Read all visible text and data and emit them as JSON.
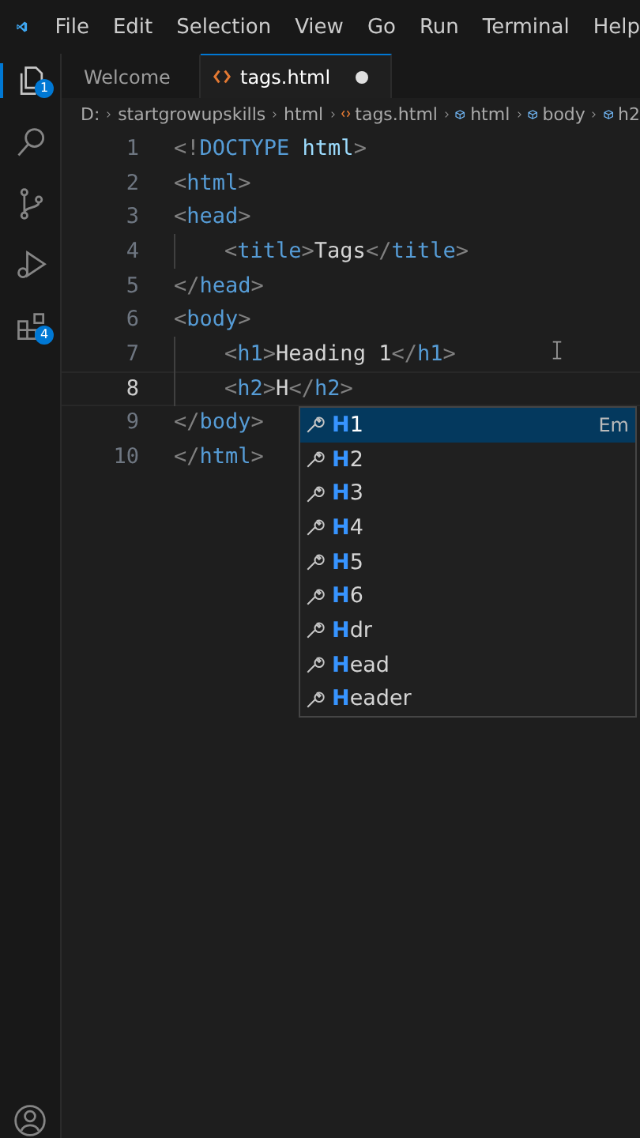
{
  "menu": [
    "File",
    "Edit",
    "Selection",
    "View",
    "Go",
    "Run",
    "Terminal",
    "Help"
  ],
  "activity_bar": [
    {
      "kind": "files",
      "badge": "1",
      "selected": true
    },
    {
      "kind": "search",
      "selected": false
    },
    {
      "kind": "source-control",
      "selected": false
    },
    {
      "kind": "run-debug",
      "selected": false
    },
    {
      "kind": "extensions",
      "badge": "4",
      "selected": false
    }
  ],
  "tabs": [
    {
      "label": "Welcome",
      "kind": "vscode",
      "selected": false
    },
    {
      "label": "tags.html",
      "kind": "html",
      "selected": true,
      "dirty": true
    }
  ],
  "breadcrumbs": [
    {
      "label": "D:",
      "kind": "folder"
    },
    {
      "label": "startgrowupskills",
      "kind": "folder"
    },
    {
      "label": "html",
      "kind": "folder"
    },
    {
      "label": "tags.html",
      "kind": "html"
    },
    {
      "label": "html",
      "kind": "element"
    },
    {
      "label": "body",
      "kind": "element"
    },
    {
      "label": "h2",
      "kind": "element"
    }
  ],
  "editor": {
    "lines": [
      {
        "number": "1",
        "current": false,
        "indent": false,
        "tokens": [
          {
            "kind": "punct",
            "text": "<!"
          },
          {
            "kind": "tag",
            "text": "DOCTYPE"
          },
          {
            "kind": "attr",
            "text": " html"
          },
          {
            "kind": "punct",
            "text": ">"
          }
        ]
      },
      {
        "number": "2",
        "current": false,
        "indent": false,
        "tokens": [
          {
            "kind": "punct",
            "text": "<"
          },
          {
            "kind": "tag",
            "text": "html"
          },
          {
            "kind": "punct",
            "text": ">"
          }
        ]
      },
      {
        "number": "3",
        "current": false,
        "indent": false,
        "tokens": [
          {
            "kind": "punct",
            "text": "<"
          },
          {
            "kind": "tag",
            "text": "head"
          },
          {
            "kind": "punct",
            "text": ">"
          }
        ]
      },
      {
        "number": "4",
        "current": false,
        "indent": true,
        "tokens": [
          {
            "kind": "punct",
            "text": "<"
          },
          {
            "kind": "tag",
            "text": "title"
          },
          {
            "kind": "punct",
            "text": ">"
          },
          {
            "kind": "text",
            "text": "Tags"
          },
          {
            "kind": "punct",
            "text": "</"
          },
          {
            "kind": "tag",
            "text": "title"
          },
          {
            "kind": "punct",
            "text": ">"
          }
        ]
      },
      {
        "number": "5",
        "current": false,
        "indent": false,
        "tokens": [
          {
            "kind": "punct",
            "text": "</"
          },
          {
            "kind": "tag",
            "text": "head"
          },
          {
            "kind": "punct",
            "text": ">"
          }
        ]
      },
      {
        "number": "6",
        "current": false,
        "indent": false,
        "tokens": [
          {
            "kind": "punct",
            "text": "<"
          },
          {
            "kind": "tag",
            "text": "body"
          },
          {
            "kind": "punct",
            "text": ">"
          }
        ]
      },
      {
        "number": "7",
        "current": false,
        "indent": true,
        "tokens": [
          {
            "kind": "punct",
            "text": "<"
          },
          {
            "kind": "tag",
            "text": "h1"
          },
          {
            "kind": "punct",
            "text": ">"
          },
          {
            "kind": "text",
            "text": "Heading 1"
          },
          {
            "kind": "punct",
            "text": "</"
          },
          {
            "kind": "tag",
            "text": "h1"
          },
          {
            "kind": "punct",
            "text": ">"
          }
        ]
      },
      {
        "number": "8",
        "current": true,
        "indent": true,
        "tokens": [
          {
            "kind": "punct",
            "text": "<"
          },
          {
            "kind": "tag",
            "text": "h2"
          },
          {
            "kind": "punct",
            "text": ">"
          },
          {
            "kind": "text",
            "text": "H"
          },
          {
            "kind": "punct",
            "text": "</"
          },
          {
            "kind": "tag",
            "text": "h2"
          },
          {
            "kind": "punct",
            "text": ">"
          }
        ]
      },
      {
        "number": "9",
        "current": false,
        "indent": false,
        "tokens": [
          {
            "kind": "punct",
            "text": "</"
          },
          {
            "kind": "tag",
            "text": "body"
          },
          {
            "kind": "punct",
            "text": ">"
          }
        ]
      },
      {
        "number": "10",
        "current": false,
        "indent": false,
        "tokens": [
          {
            "kind": "punct",
            "text": "</"
          },
          {
            "kind": "tag",
            "text": "html"
          },
          {
            "kind": "punct",
            "text": ">"
          }
        ]
      }
    ]
  },
  "suggestions": [
    {
      "match": "H",
      "rest": "1",
      "detail": "Em",
      "selected": true
    },
    {
      "match": "H",
      "rest": "2",
      "selected": false
    },
    {
      "match": "H",
      "rest": "3",
      "selected": false
    },
    {
      "match": "H",
      "rest": "4",
      "selected": false
    },
    {
      "match": "H",
      "rest": "5",
      "selected": false
    },
    {
      "match": "H",
      "rest": "6",
      "selected": false
    },
    {
      "match": "H",
      "rest": "dr",
      "selected": false
    },
    {
      "match": "H",
      "rest": "ead",
      "selected": false
    },
    {
      "match": "H",
      "rest": "eader",
      "selected": false
    }
  ]
}
